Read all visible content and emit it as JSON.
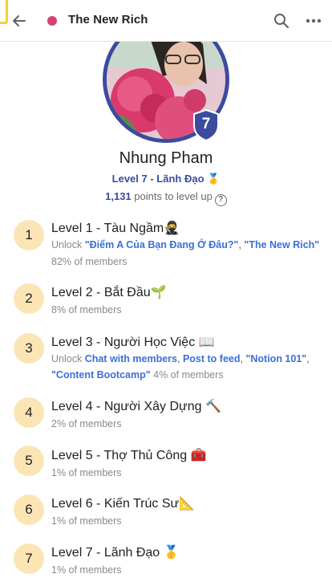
{
  "header": {
    "title": "The New Rich",
    "dot_color": "#d8426f",
    "back_icon": "arrow-left-icon",
    "search_icon": "search-icon",
    "more_icon": "more-horizontal-icon"
  },
  "profile": {
    "name": "Nhung Pham",
    "level_badge": "7",
    "level_text": "Level 7 - Lãnh Đạo 🥇",
    "points_number": "1,131",
    "points_text": " points to level up",
    "help_icon": "?"
  },
  "levels": [
    {
      "number": "1",
      "title": "Level 1 - Tàu Ngầm🥷",
      "unlock_prefix": "Unlock ",
      "links": [
        "\"Điểm A Của Bạn Đang Ở Đâu?\"",
        "\"The New Rich\""
      ],
      "links_line2": [],
      "members": "82% of members"
    },
    {
      "number": "2",
      "title": "Level 2 - Bắt Đầu🌱",
      "members": "8% of members"
    },
    {
      "number": "3",
      "title": "Level 3 - Người Học Việc 📖",
      "unlock_prefix": "Unlock ",
      "links": [
        "Chat with members",
        "Post to feed",
        "\"Notion 101\""
      ],
      "links_line2": [
        "\"Content Bootcamp\""
      ],
      "members": "4% of members"
    },
    {
      "number": "4",
      "title": "Level 4 - Người Xây Dựng 🔨",
      "members": "2% of members"
    },
    {
      "number": "5",
      "title": "Level 5 - Thợ Thủ Công 🧰",
      "members": "1% of members"
    },
    {
      "number": "6",
      "title": "Level 6 - Kiến Trúc Sư📐",
      "members": "1% of members"
    },
    {
      "number": "7",
      "title": "Level 7 - Lãnh Đạo 🥇",
      "members": "1% of members"
    }
  ],
  "colors": {
    "accent": "#3b4b9e",
    "link": "#3a6fd8",
    "level_circle": "#fce5b4"
  }
}
